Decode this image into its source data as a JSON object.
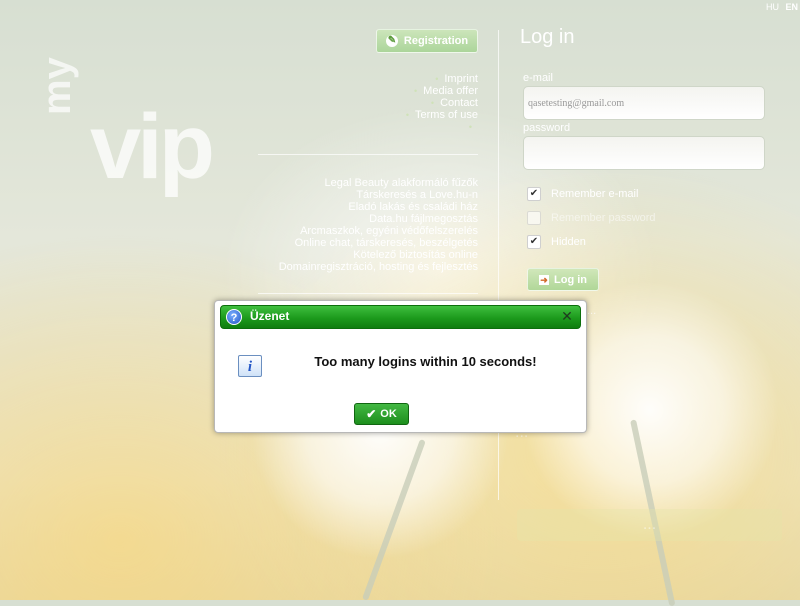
{
  "lang": {
    "hu": "HU",
    "en": "EN"
  },
  "brand": {
    "my": "my",
    "vip": "vip"
  },
  "registration_label": "Registration",
  "nav_links": [
    "Imprint",
    "Media offer",
    "Contact",
    "Terms of use",
    ""
  ],
  "partners": [
    "Legal Beauty alakformáló fűzők",
    "Társkeresés a Love.hu-n",
    "Eladó lakás és családi ház",
    "Data.hu fájlmegosztás",
    "Arcmaszkok, egyéni védőfelszerelés",
    "Online chat, társkeresés, beszélgetés",
    "Kötelező biztosítás online",
    "Domainregisztráció, hosting és fejlesztés"
  ],
  "login": {
    "title": "Log in",
    "email_label": "e-mail",
    "email_value": "qasetesting@gmail.com",
    "password_label": "password",
    "remember_email": "Remember e-mail",
    "remember_password": "Remember password",
    "hidden": "Hidden",
    "login_button": "Log in",
    "forgot": "...",
    "promo_text": "...",
    "promo_button": "..."
  },
  "modal": {
    "title": "Üzenet",
    "message": "Too many logins within 10 seconds!",
    "ok_label": "OK"
  },
  "colors": {
    "modal_title_green": "#1c9a1c",
    "ok_green": "#1d8f1d",
    "info_blue": "#2456c6"
  },
  "icons": [
    "question-icon",
    "close-icon",
    "info-icon",
    "check-icon",
    "registration-icon",
    "login-arrow-icon"
  ]
}
